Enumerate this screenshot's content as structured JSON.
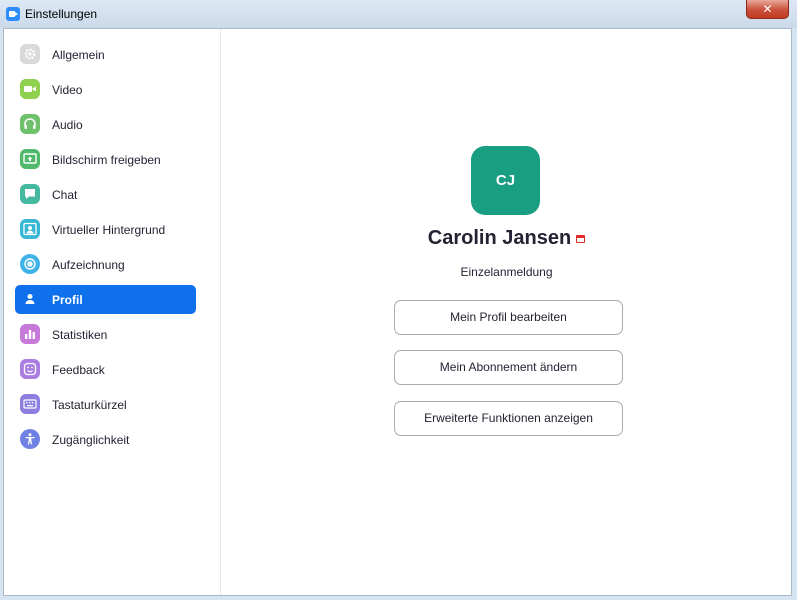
{
  "window": {
    "title": "Einstellungen",
    "close_symbol": "✕"
  },
  "sidebar": {
    "items": [
      {
        "label": "Allgemein",
        "icon": "gear-icon",
        "color": "#c8c8cc"
      },
      {
        "label": "Video",
        "icon": "video-camera-icon",
        "color": "#8fd14f"
      },
      {
        "label": "Audio",
        "icon": "headphones-icon",
        "color": "#6fc26b"
      },
      {
        "label": "Bildschirm freigeben",
        "icon": "share-screen-icon",
        "color": "#4fb86a"
      },
      {
        "label": "Chat",
        "icon": "chat-bubble-icon",
        "color": "#45b8a0"
      },
      {
        "label": "Virtueller Hintergrund",
        "icon": "virtual-background-icon",
        "color": "#37b7d6"
      },
      {
        "label": "Aufzeichnung",
        "icon": "record-icon",
        "color": "#3fb3e8"
      },
      {
        "label": "Profil",
        "icon": "profile-icon",
        "color": "#0e71eb",
        "active": true
      },
      {
        "label": "Statistiken",
        "icon": "statistics-icon",
        "color": "#c779d9"
      },
      {
        "label": "Feedback",
        "icon": "feedback-smiley-icon",
        "color": "#a97ee0"
      },
      {
        "label": "Tastaturkürzel",
        "icon": "keyboard-icon",
        "color": "#8c7fe0"
      },
      {
        "label": "Zugänglichkeit",
        "icon": "accessibility-icon",
        "color": "#6f82e3"
      }
    ]
  },
  "profile": {
    "initials": "CJ",
    "avatar_color": "#1a9e82",
    "name": "Carolin Jansen",
    "account_type": "Einzelanmeldung",
    "buttons": {
      "edit_profile": "Mein Profil bearbeiten",
      "change_subscription": "Mein Abonnement ändern",
      "advanced_features": "Erweiterte Funktionen anzeigen"
    }
  }
}
